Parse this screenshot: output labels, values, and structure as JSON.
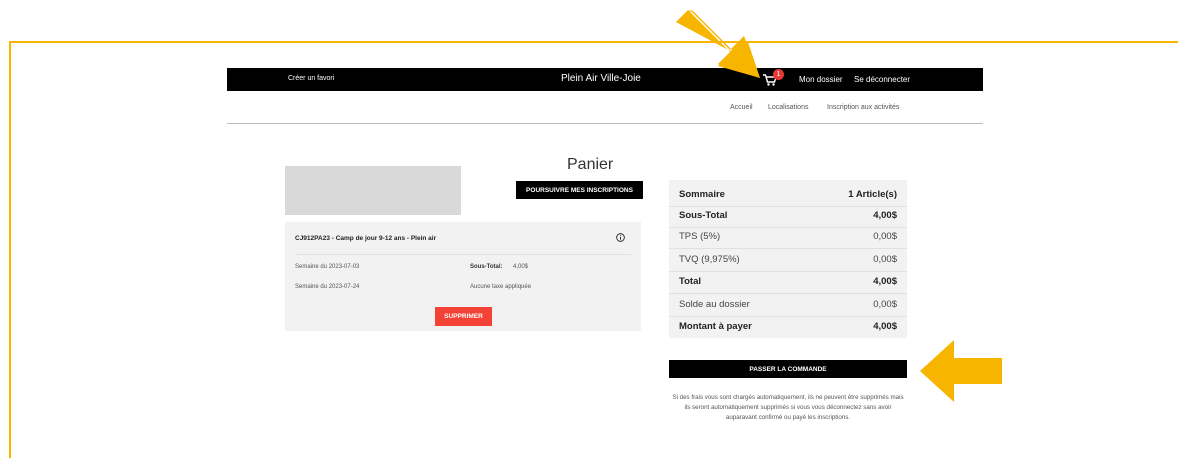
{
  "header": {
    "favorite_link": "Créer un favori",
    "brand": "Plein Air Ville-Joie",
    "cart_count": "1",
    "my_account": "Mon dossier",
    "logout": "Se déconnecter"
  },
  "nav": {
    "items": [
      {
        "label": "Accueil"
      },
      {
        "label": "Localisations"
      },
      {
        "label": "Inscription aux activités"
      }
    ]
  },
  "cart": {
    "title": "Panier",
    "continue_button": "POURSUIVRE MES INSCRIPTIONS",
    "item": {
      "title": "CJ912PA23 - Camp de jour 9-12 ans - Plein air",
      "weeks": [
        "Semaine du 2023-07-03",
        "Semaine du 2023-07-24"
      ],
      "subtotal_label": "Sous-Total:",
      "subtotal_value": "4,00$",
      "tax_note": "Aucune taxe appliquée",
      "delete_button": "SUPPRIMER"
    }
  },
  "summary": {
    "title": "Sommaire",
    "count": "1 Article(s)",
    "rows": [
      {
        "label": "Sous-Total",
        "value": "4,00$"
      },
      {
        "label": "TPS (5%)",
        "value": "0,00$"
      },
      {
        "label": "TVQ (9,975%)",
        "value": "0,00$"
      },
      {
        "label": "Total",
        "value": "4,00$"
      },
      {
        "label": "Solde au dossier",
        "value": "0,00$"
      },
      {
        "label": "Montant à payer",
        "value": "4,00$"
      }
    ],
    "order_button": "PASSER LA COMMANDE",
    "notice": "Si des frais vous sont chargés automatiquement, ils ne peuvent être supprimés mais ils seront automatiquement supprimés si vous vous déconnectez sans avoir auparavant confirmé ou payé les inscriptions."
  },
  "colors": {
    "annotation_arrow": "#f7b500",
    "topbar": "#000000",
    "delete": "#f44336",
    "badge": "#e53935"
  }
}
